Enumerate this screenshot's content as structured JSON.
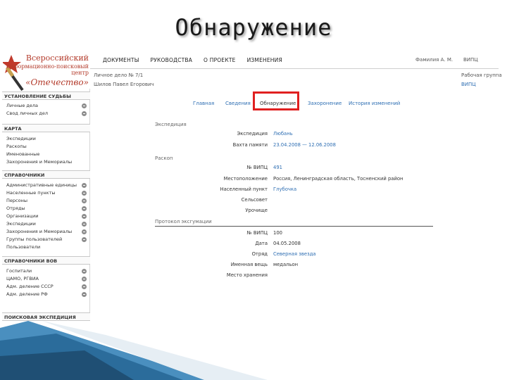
{
  "slide_title": "Обнаружение",
  "logo": {
    "line1": "Всероссийский",
    "line2": "информационно-поисковый",
    "line3": "центр",
    "line4": "«Отечество»"
  },
  "topnav": [
    "ДОКУМЕНТЫ",
    "РУКОВОДСТВА",
    "О ПРОЕКТЕ",
    "ИЗМЕНЕНИЯ"
  ],
  "top_user": "Фамилия А. М.",
  "top_org": "ВИПЦ",
  "card": {
    "line1": "Личное дело № 7/1",
    "line2": "Шилов Павел Егорович"
  },
  "right_group": {
    "line1": "Рабочая группа",
    "line2": "ВИПЦ"
  },
  "sidebar": {
    "sections": [
      {
        "title": "УСТАНОВЛЕНИЕ СУДЬБЫ",
        "items": [
          "Личные дела",
          "Свод личных дел"
        ]
      },
      {
        "title": "КАРТА",
        "items": [
          "Экспедиции",
          "Раскопы",
          "Именованные",
          "Захоронения и Мемориалы"
        ]
      },
      {
        "title": "СПРАВОЧНИКИ",
        "items": [
          "Административные единицы",
          "Населенные пункты",
          "Персоны",
          "Отряды",
          "Организации",
          "Экспедиции",
          "Захоронения и Мемориалы",
          "Группы пользователей",
          "Пользователи"
        ]
      },
      {
        "title": "СПРАВОЧНИКИ ВОВ",
        "items": [
          "Госпитали",
          "ЦАМО, РГВИА",
          "Адм. деление СССР",
          "Адм. деление РФ"
        ]
      },
      {
        "title": "ПОИСКОВАЯ ЭКСПЕДИЦИЯ",
        "items": []
      }
    ]
  },
  "tabs": [
    "Главная",
    "Сведения",
    "Обнаружение",
    "Захоронение",
    "История изменений"
  ],
  "groups": {
    "expedition": "Экспедиция",
    "excavation": "Раскоп",
    "protocol": "Протокол эксгумации"
  },
  "fields": {
    "expedition_label": "Экспедиция",
    "expedition_value": "Любань",
    "period_label": "Вахта памяти",
    "period_value": "23.04.2008 — 12.06.2008",
    "vipc_label": "№ ВИПЦ",
    "vipc_value": "491",
    "location_label": "Местоположение",
    "location_value": "Россия, Ленинградская область, Тосненский район",
    "settlement_label": "Населенный пункт",
    "settlement_value": "Глубочка",
    "village_label": "Сельсовет",
    "village_value": "",
    "tract_label": "Урочище",
    "tract_value": "",
    "p_vipc_label": "№ ВИПЦ",
    "p_vipc_value": "100",
    "p_date_label": "Дата",
    "p_date_value": "04.05.2008",
    "p_squad_label": "Отряд",
    "p_squad_value": "Северная звезда",
    "p_item_label": "Именная вещь",
    "p_item_value": "медальон",
    "p_storage_label": "Место хранения",
    "p_storage_value": ""
  },
  "colors": {
    "accent_red": "#e02020",
    "link_blue": "#2f6fb3",
    "logo_red": "#b33a2a"
  }
}
